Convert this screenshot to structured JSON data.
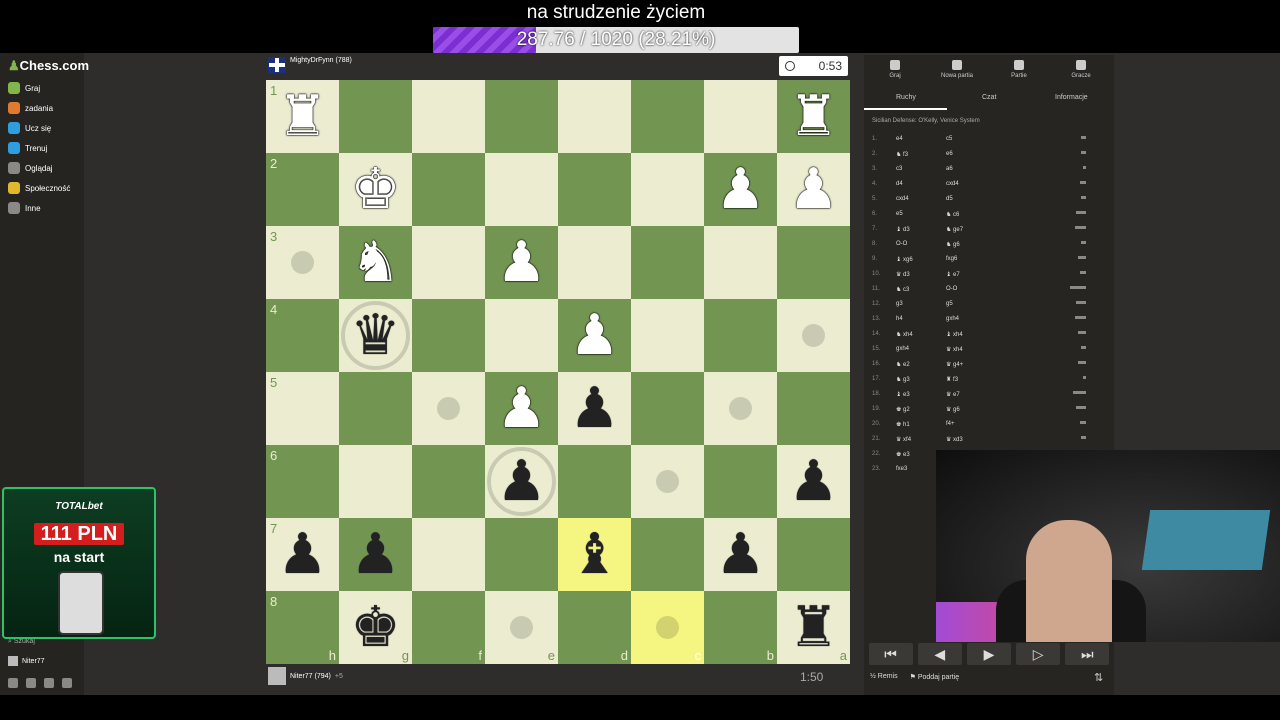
{
  "stream": {
    "title": "na strudzenie życiem",
    "progress_text": "287.76 / 1020 (28.21%)",
    "progress_fraction": 0.2821
  },
  "sidebar": {
    "logo": "Chess.com",
    "items": [
      {
        "label": "Graj",
        "color": "#81b64c"
      },
      {
        "label": "zadania",
        "color": "#e07a2f"
      },
      {
        "label": "Ucz się",
        "color": "#2f9ee0"
      },
      {
        "label": "Trenuj",
        "color": "#2f9ee0"
      },
      {
        "label": "Oglądaj",
        "color": "#8b8987"
      },
      {
        "label": "Społeczność",
        "color": "#e0b72f"
      },
      {
        "label": "Inne",
        "color": "#8b8987"
      }
    ],
    "search_placeholder": "Szukaj",
    "username": "Niter77"
  },
  "ad": {
    "brand": "TOTALbet",
    "amount": "111 PLN",
    "subtitle": "na start"
  },
  "top_player": {
    "name": "MightyDrFynn (788)",
    "clock": "0:53"
  },
  "bottom_player": {
    "name": "Niter77 (794)",
    "clock": "1:50",
    "material": "+5"
  },
  "board": {
    "ranks": [
      "1",
      "2",
      "3",
      "4",
      "5",
      "6",
      "7",
      "8"
    ],
    "files": [
      "h",
      "g",
      "f",
      "e",
      "d",
      "c",
      "b",
      "a"
    ],
    "squares": [
      [
        "wR",
        "",
        "",
        "",
        "",
        "",
        "",
        "wR"
      ],
      [
        "",
        "wK",
        "",
        "",
        "",
        "",
        "wP",
        "wP"
      ],
      [
        "hint",
        "wN",
        "",
        "wP",
        "",
        "",
        "",
        ""
      ],
      [
        "",
        "bQcap",
        "",
        "",
        "wP",
        "",
        "",
        "hint"
      ],
      [
        "",
        "",
        "hint",
        "wP",
        "bP",
        "",
        "hint",
        ""
      ],
      [
        "",
        "",
        "",
        "bPcap",
        "",
        "hint",
        "",
        "bP"
      ],
      [
        "bP",
        "bP",
        "",
        "",
        "bB",
        "",
        "bP",
        ""
      ],
      [
        "",
        "bK",
        "",
        "hint",
        "",
        "hint",
        "",
        "bR"
      ]
    ],
    "highlight": [
      [
        6,
        4
      ],
      [
        7,
        5
      ]
    ]
  },
  "panel": {
    "top_tabs": [
      "Graj",
      "Nowa partia",
      "Partie",
      "Gracze"
    ],
    "sub_tabs": [
      "Ruchy",
      "Czat",
      "Informacje"
    ],
    "opening": "Sicilian Defense: O'Kelly, Venice System",
    "moves": [
      {
        "n": "1.",
        "w": "e4",
        "b": "c5",
        "t": 0.3
      },
      {
        "n": "2.",
        "w": "♞ f3",
        "b": "e6",
        "t": 0.3
      },
      {
        "n": "3.",
        "w": "c3",
        "b": "a6",
        "t": 0.2
      },
      {
        "n": "4.",
        "w": "d4",
        "b": "cxd4",
        "t": 0.4
      },
      {
        "n": "5.",
        "w": "cxd4",
        "b": "d5",
        "t": 0.3
      },
      {
        "n": "6.",
        "w": "e5",
        "b": "♞ c6",
        "t": 0.6
      },
      {
        "n": "7.",
        "w": "♝ d3",
        "b": "♞ ge7",
        "t": 0.7
      },
      {
        "n": "8.",
        "w": "O-O",
        "b": "♞ g6",
        "t": 0.3
      },
      {
        "n": "9.",
        "w": "♝ xg6",
        "b": "fxg6",
        "t": 0.5
      },
      {
        "n": "10.",
        "w": "♛ d3",
        "b": "♝ e7",
        "t": 0.4
      },
      {
        "n": "11.",
        "w": "♞ c3",
        "b": "O-O",
        "t": 1.0
      },
      {
        "n": "12.",
        "w": "g3",
        "b": "g5",
        "t": 0.6
      },
      {
        "n": "13.",
        "w": "h4",
        "b": "gxh4",
        "t": 0.7
      },
      {
        "n": "14.",
        "w": "♞ xh4",
        "b": "♝ xh4",
        "t": 0.5
      },
      {
        "n": "15.",
        "w": "gxh4",
        "b": "♛ xh4",
        "t": 0.3
      },
      {
        "n": "16.",
        "w": "♞ e2",
        "b": "♛ g4+",
        "t": 0.5
      },
      {
        "n": "17.",
        "w": "♞ g3",
        "b": "♜ f3",
        "t": 0.2
      },
      {
        "n": "18.",
        "w": "♝ e3",
        "b": "♛ e7",
        "t": 0.8
      },
      {
        "n": "19.",
        "w": "♚ g2",
        "b": "♛ g6",
        "t": 0.6
      },
      {
        "n": "20.",
        "w": "♚ h1",
        "b": "f4+",
        "t": 0.4
      },
      {
        "n": "21.",
        "w": "♛ xf4",
        "b": "♛ xd3",
        "t": 0.3
      },
      {
        "n": "22.",
        "w": "♚ e3",
        "b": "",
        "t": 0.2
      },
      {
        "n": "23.",
        "w": "fxe3",
        "b": "",
        "t": 0
      }
    ],
    "nav": [
      "⏮",
      "◀",
      "▶",
      "▷",
      "⏭"
    ],
    "actions": [
      "½ Remis",
      "⚑ Poddaj partię"
    ]
  }
}
